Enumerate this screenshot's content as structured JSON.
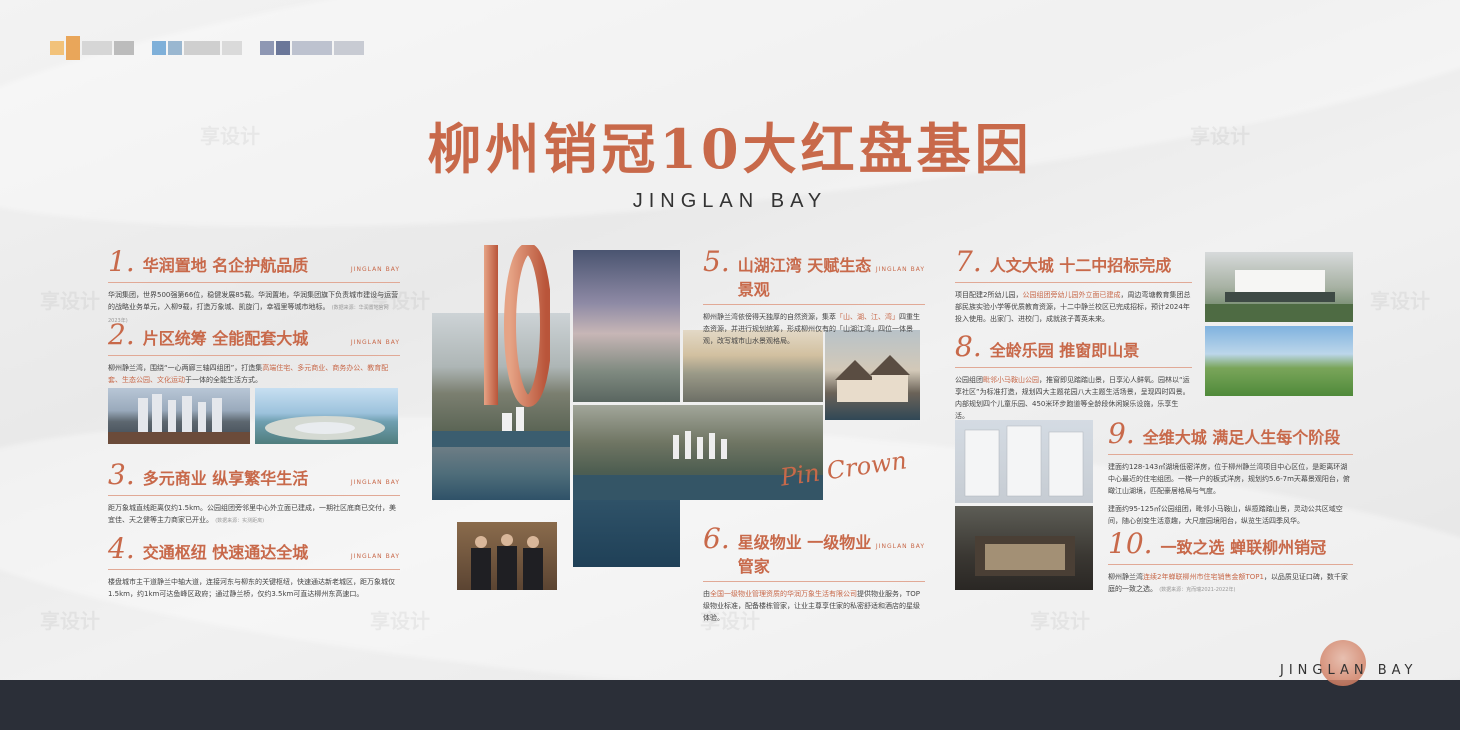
{
  "header": {
    "title": "柳州销冠10大红盘基因",
    "subtitle": "JINGLAN BAY"
  },
  "brand": {
    "mini": "JINGLAN BAY",
    "footer": "JINGLAN BAY",
    "script": "Pin Crown"
  },
  "watermark": "享设计",
  "colors": {
    "accent": "#c8694a",
    "footer_bg": "#2b2f38"
  },
  "sections": [
    {
      "num": "1.",
      "title": "华润置地 名企护航品质",
      "body": "华润集团，世界500强第66位，稳健发展85载。华润置地，华润集团旗下负责城市建设与运营的战略业务单元，入柳9载，打造万象城、凯旋门，幸福里等城市地标。",
      "note": "(数据来源：华润置地官网2023年)"
    },
    {
      "num": "2.",
      "title": "片区统筹 全能配套大城",
      "body": "柳州静兰湾，围绕“一心两廊三轴四组团”，打造集",
      "body_hl": "高端住宅、多元商业、商务办公、教育配套、生态公园、文化运动",
      "body_tail": "于一体的全能生活方式。"
    },
    {
      "num": "3.",
      "title": "多元商业 纵享繁华生活",
      "body": "距万象城直线距离仅约1.5km。公园组团旁邻里中心外立面已建成，一期社区底商已交付，美宜佳、天之健等主力商家已开业。",
      "note": "(数据来源：实测距离)"
    },
    {
      "num": "4.",
      "title": "交通枢纽 快速通达全城",
      "body": "楼盘城市主干道静兰中轴大道，连接河东与柳东的关键枢纽，快速通达新老城区，距万象城仅1.5km，约1km可达鱼峰区政府；通过静兰桥，仅约3.5km可直达柳州东高速口。"
    },
    {
      "num": "5.",
      "title": "山湖江湾 天赋生态景观",
      "body": "柳州静兰湾依傍得天独厚的自然资源，集萃",
      "body_hl": "「山、湖、江、湾」",
      "body_tail": "四重生态资源，并进行规划统筹，形成柳州仅有的「山湖江湾」四位一体景观，改写城市山水景观格局。"
    },
    {
      "num": "6.",
      "title": "星级物业 一级物业管家",
      "body": "由",
      "body_hl": "全国一级物业管理资质的华润万象生活有限公司",
      "body_tail": "提供物业服务，TOP级物业标准，配备楼栋管家，让业主尊享住家的私密舒适和酒店的星级体验。"
    },
    {
      "num": "7.",
      "title": "人文大城 十二中招标完成",
      "body": "项目配建2所幼儿园，",
      "body_hl": "公园组团旁幼儿园外立面已建成",
      "body_tail": "，周边弯塘教育集团总部民族实验小学等优质教育资源，十二中静兰校区已完成招标，预计2024年投入使用。出家门、进校门，成就孩子菁英未来。"
    },
    {
      "num": "8.",
      "title": "全龄乐园 推窗即山景",
      "body": "公园组团",
      "body_hl": "毗邻小马鞍山公园",
      "body_tail": "，推窗即见踏踏山景，日享沁人鲜氧。园林以“运享社区”为标准打造，规划四大主题花园八大主题生活场景，呈现四时四景。内部规划四个儿童乐园、450米环步跑道等全龄段休闲娱乐设施，乐享生活。"
    },
    {
      "num": "9.",
      "title": "全维大城 满足人生每个阶段",
      "body": "建面约128-143㎡湖境低密洋房，位于柳州静兰湾项目中心区位，是距离环湖中心最近的住宅组团。一梯一户的板式洋房，规划约5.6-7m天幕景观阳台，俯瞰江山湖境，匹配豪居格局与气度。",
      "body2": "建面约95-125㎡公园组团，毗邻小马鞍山，纵揽踏踏山景，灵动公共区域空间，随心创变生活意趣，大尺度园境阳台，纵览生活四季风华。"
    },
    {
      "num": "10.",
      "title": "一致之选 蝉联柳州销冠",
      "body": "柳州静兰湾",
      "body_hl": "连续2年蝉联柳州市住宅销售金额TOP1",
      "body_tail": "，以品质见证口碑，数千家庭的一致之选。",
      "note": "(数据来源：克而瑞2021-2022年)"
    }
  ],
  "footer": {
    "fine_print": ""
  }
}
